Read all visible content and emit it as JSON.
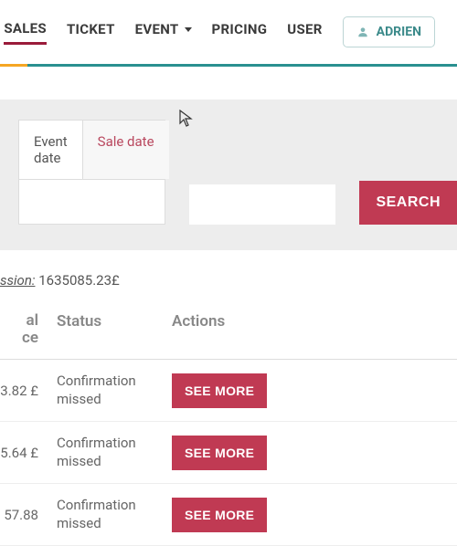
{
  "nav": {
    "items": [
      {
        "label": "SALES",
        "active": true
      },
      {
        "label": "TICKET",
        "active": false
      },
      {
        "label": "EVENT",
        "active": false,
        "dropdown": true
      },
      {
        "label": "PRICING",
        "active": false
      },
      {
        "label": "USER",
        "active": false
      }
    ],
    "user_name": "ADRIEN"
  },
  "filters": {
    "tabs": {
      "event_date": "Event date",
      "sale_date": "Sale date",
      "active": "event_date"
    },
    "search_label": "SEARCH"
  },
  "summary": {
    "label": "ssion:",
    "value": "1635085.23£"
  },
  "table": {
    "headers": {
      "price": "al\nce",
      "status": "Status",
      "actions": "Actions"
    },
    "rows": [
      {
        "price": "3.82 £",
        "status": "Confirmation missed",
        "action": "SEE MORE"
      },
      {
        "price": "5.64 £",
        "status": "Confirmation missed",
        "action": "SEE MORE"
      },
      {
        "price": "57.88",
        "status": "Confirmation missed",
        "action": "SEE MORE"
      }
    ]
  }
}
